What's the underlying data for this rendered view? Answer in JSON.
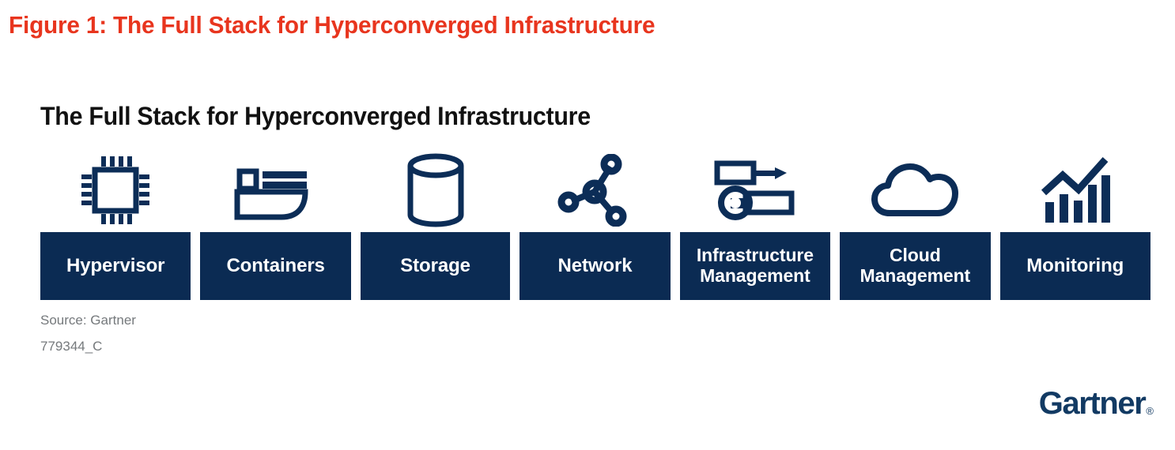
{
  "figure": {
    "title": "Figure 1: The Full Stack for Hyperconverged Infrastructure",
    "title_color": "#E8351E"
  },
  "graphic": {
    "heading": "The Full Stack for Hyperconverged Infrastructure",
    "heading_color": "#111111",
    "box_color": "#0B2B53",
    "icon_color": "#0C2D57",
    "label_color": "#FFFFFF",
    "items": [
      {
        "label": "Hypervisor",
        "icon": "cpu-chip-icon",
        "lines": 1
      },
      {
        "label": "Containers",
        "icon": "container-ship-icon",
        "lines": 1
      },
      {
        "label": "Storage",
        "icon": "database-cylinder-icon",
        "lines": 1
      },
      {
        "label": "Network",
        "icon": "network-nodes-icon",
        "lines": 1
      },
      {
        "label": "Infrastructure\nManagement",
        "icon": "tools-wrench-icon",
        "lines": 2
      },
      {
        "label": "Cloud\nManagement",
        "icon": "cloud-icon",
        "lines": 2
      },
      {
        "label": "Monitoring",
        "icon": "bar-chart-trend-icon",
        "lines": 1
      }
    ]
  },
  "source": {
    "text": "Source: Gartner",
    "id": "779344_C",
    "color": "#75797C"
  },
  "branding": {
    "wordmark": "Gartner",
    "mark": "®",
    "color": "#123A63"
  }
}
